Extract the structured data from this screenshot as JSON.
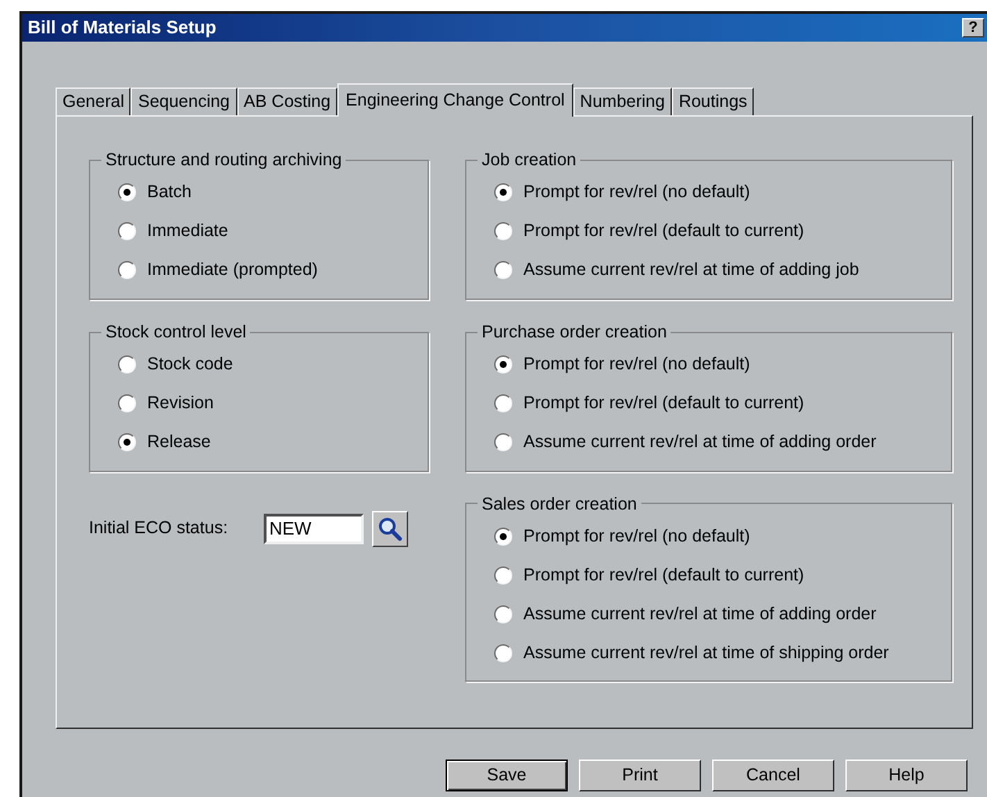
{
  "window": {
    "title": "Bill of Materials Setup",
    "help_glyph": "?"
  },
  "tabs": [
    {
      "label": "General",
      "selected": false
    },
    {
      "label": "Sequencing",
      "selected": false
    },
    {
      "label": "AB Costing",
      "selected": false
    },
    {
      "label": "Engineering Change Control",
      "selected": true
    },
    {
      "label": "Numbering",
      "selected": false
    },
    {
      "label": "Routings",
      "selected": false
    }
  ],
  "left_groups": [
    {
      "title": "Structure and routing archiving",
      "options": [
        {
          "label": "Batch",
          "selected": true
        },
        {
          "label": "Immediate",
          "selected": false
        },
        {
          "label": "Immediate (prompted)",
          "selected": false
        }
      ]
    },
    {
      "title": "Stock control level",
      "options": [
        {
          "label": "Stock code",
          "selected": false
        },
        {
          "label": "Revision",
          "selected": false
        },
        {
          "label": "Release",
          "selected": true
        }
      ]
    }
  ],
  "eco_status": {
    "label": "Initial ECO status:",
    "value": "NEW"
  },
  "right_groups": [
    {
      "title": "Job creation",
      "options": [
        {
          "label": "Prompt for rev/rel (no default)",
          "selected": true
        },
        {
          "label": "Prompt for rev/rel (default to current)",
          "selected": false
        },
        {
          "label": "Assume current rev/rel at time of adding job",
          "selected": false
        }
      ]
    },
    {
      "title": "Purchase order creation",
      "options": [
        {
          "label": "Prompt for rev/rel (no default)",
          "selected": true
        },
        {
          "label": "Prompt for rev/rel (default to current)",
          "selected": false
        },
        {
          "label": "Assume current rev/rel at time of adding order",
          "selected": false
        }
      ]
    },
    {
      "title": "Sales order creation",
      "options": [
        {
          "label": "Prompt for rev/rel (no default)",
          "selected": true
        },
        {
          "label": "Prompt for rev/rel (default to current)",
          "selected": false
        },
        {
          "label": "Assume current rev/rel at time of adding order",
          "selected": false
        },
        {
          "label": "Assume current rev/rel at time of shipping order",
          "selected": false
        }
      ]
    }
  ],
  "buttons": [
    {
      "label": "Save",
      "default": true
    },
    {
      "label": "Print",
      "default": false
    },
    {
      "label": "Cancel",
      "default": false
    },
    {
      "label": "Help",
      "default": false
    }
  ]
}
